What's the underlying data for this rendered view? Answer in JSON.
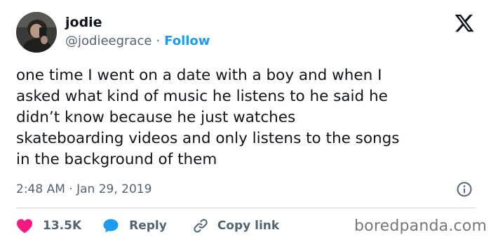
{
  "author": {
    "name": "jodie",
    "handle": "@jodieegrace",
    "separator": "·",
    "follow_label": "Follow"
  },
  "icons": {
    "avatar": "profile-photo",
    "platform": "x-logo-icon",
    "info": "info-icon",
    "like": "heart-icon",
    "reply": "speech-bubble-icon",
    "copy": "link-icon"
  },
  "tweet": {
    "lines": [
      "one time I went on a date with a boy and when I",
      "asked what kind of music he listens to he said he",
      "didn’t know because he just watches",
      "skateboarding videos and only listens to the songs",
      "in the background of them"
    ],
    "timestamp": "2:48 AM · Jan 29, 2019"
  },
  "actions": {
    "like_count": "13.5K",
    "reply_label": "Reply",
    "copy_label": "Copy link"
  },
  "watermark": "boredpanda.com",
  "colors": {
    "accent": "#1d9bf0",
    "like": "#f91880",
    "text": "#0f1419",
    "muted": "#536471",
    "divider": "#cfd9de"
  }
}
